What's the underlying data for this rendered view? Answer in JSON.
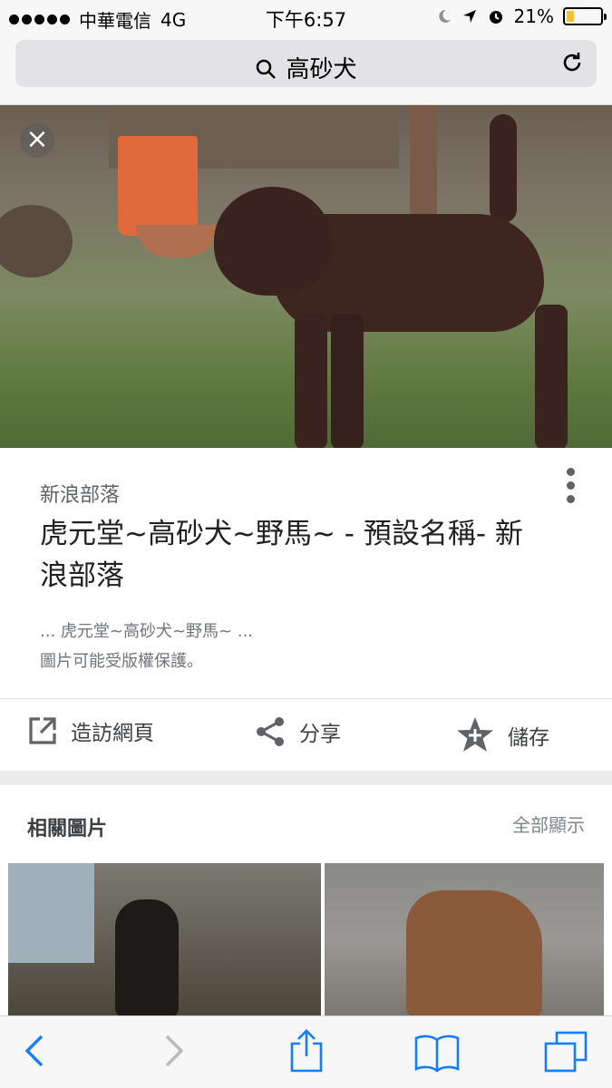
{
  "status_bar": {
    "carrier": "中華電信",
    "network": "4G",
    "time": "下午6:57",
    "battery": "21%",
    "battery_level": 0.21,
    "battery_color": "#f2c12e"
  },
  "address_bar": {
    "query": "高砂犬"
  },
  "image_card": {
    "source": "新浪部落",
    "title": "虎元堂~高砂犬~野馬~ - 預設名稱- 新浪部落",
    "snippet": "... 虎元堂~高砂犬~野馬~ ...",
    "copyright": "圖片可能受版權保護。"
  },
  "actions": {
    "visit": "造訪網頁",
    "share": "分享",
    "save": "儲存"
  },
  "related": {
    "heading": "相關圖片",
    "show_all": "全部顯示"
  },
  "icons": {
    "close": "close-icon",
    "search": "search-icon",
    "reload": "reload-icon",
    "more": "more-vert-icon",
    "visit": "open-in-new-icon",
    "share": "share-icon",
    "save": "star-icon",
    "back": "back-icon",
    "forward": "forward-icon",
    "share_sheet": "share-sheet-icon",
    "bookmarks": "bookmarks-icon",
    "tabs": "tabs-icon"
  },
  "colors": {
    "ios_blue": "#157efb",
    "google_gray": "#5f6368"
  }
}
